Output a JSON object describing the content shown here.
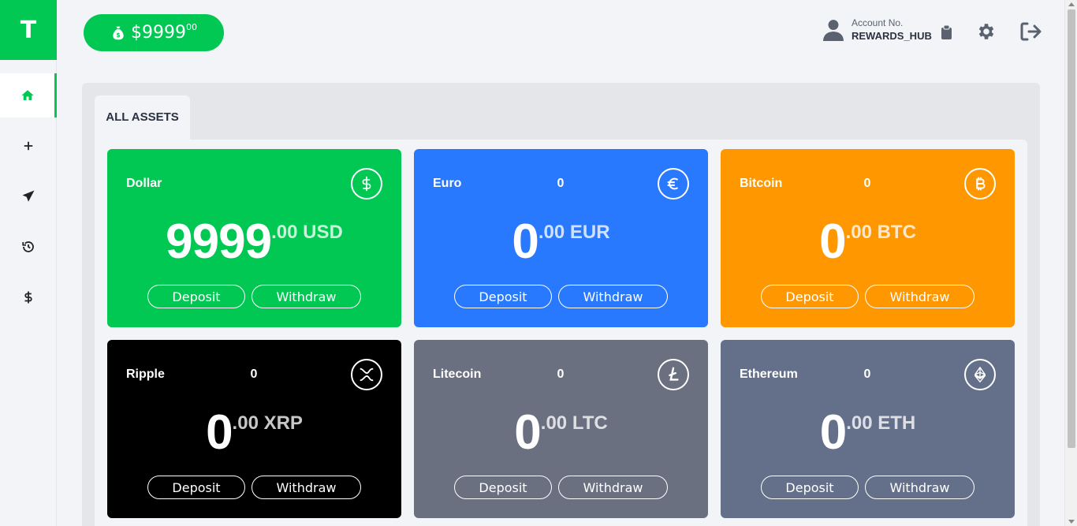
{
  "sidebar": {
    "logo_letter": "T",
    "items": [
      {
        "name": "home",
        "icon": "home-icon",
        "active": true
      },
      {
        "name": "add",
        "icon": "plus-icon",
        "active": false
      },
      {
        "name": "send",
        "icon": "send-icon",
        "active": false
      },
      {
        "name": "history",
        "icon": "history-icon",
        "active": false
      },
      {
        "name": "dollar",
        "icon": "dollar-icon",
        "active": false
      }
    ]
  },
  "header": {
    "balance_main": "$9999",
    "balance_cents": "00",
    "account_label": "Account No.",
    "account_value": "REWARDS_HUB"
  },
  "tab": {
    "label": "ALL ASSETS"
  },
  "colors": {
    "accent": "#00c853",
    "dollar": "#00c853",
    "euro": "#2979ff",
    "bitcoin": "#ff9800",
    "ripple": "#000000",
    "litecoin": "#6b7080",
    "ethereum": "#64708a"
  },
  "cards": [
    {
      "name": "Dollar",
      "side_value": "",
      "int": "9999",
      "frac": ".00 USD",
      "icon": "dollar-circle-icon",
      "deposit": "Deposit",
      "withdraw": "Withdraw"
    },
    {
      "name": "Euro",
      "side_value": "0",
      "int": "0",
      "frac": ".00 EUR",
      "icon": "euro-icon",
      "deposit": "Deposit",
      "withdraw": "Withdraw"
    },
    {
      "name": "Bitcoin",
      "side_value": "0",
      "int": "0",
      "frac": ".00 BTC",
      "icon": "bitcoin-icon",
      "deposit": "Deposit",
      "withdraw": "Withdraw"
    },
    {
      "name": "Ripple",
      "side_value": "0",
      "int": "0",
      "frac": ".00 XRP",
      "icon": "ripple-icon",
      "deposit": "Deposit",
      "withdraw": "Withdraw"
    },
    {
      "name": "Litecoin",
      "side_value": "0",
      "int": "0",
      "frac": ".00 LTC",
      "icon": "litecoin-icon",
      "deposit": "Deposit",
      "withdraw": "Withdraw"
    },
    {
      "name": "Ethereum",
      "side_value": "0",
      "int": "0",
      "frac": ".00 ETH",
      "icon": "ethereum-icon",
      "deposit": "Deposit",
      "withdraw": "Withdraw"
    }
  ]
}
